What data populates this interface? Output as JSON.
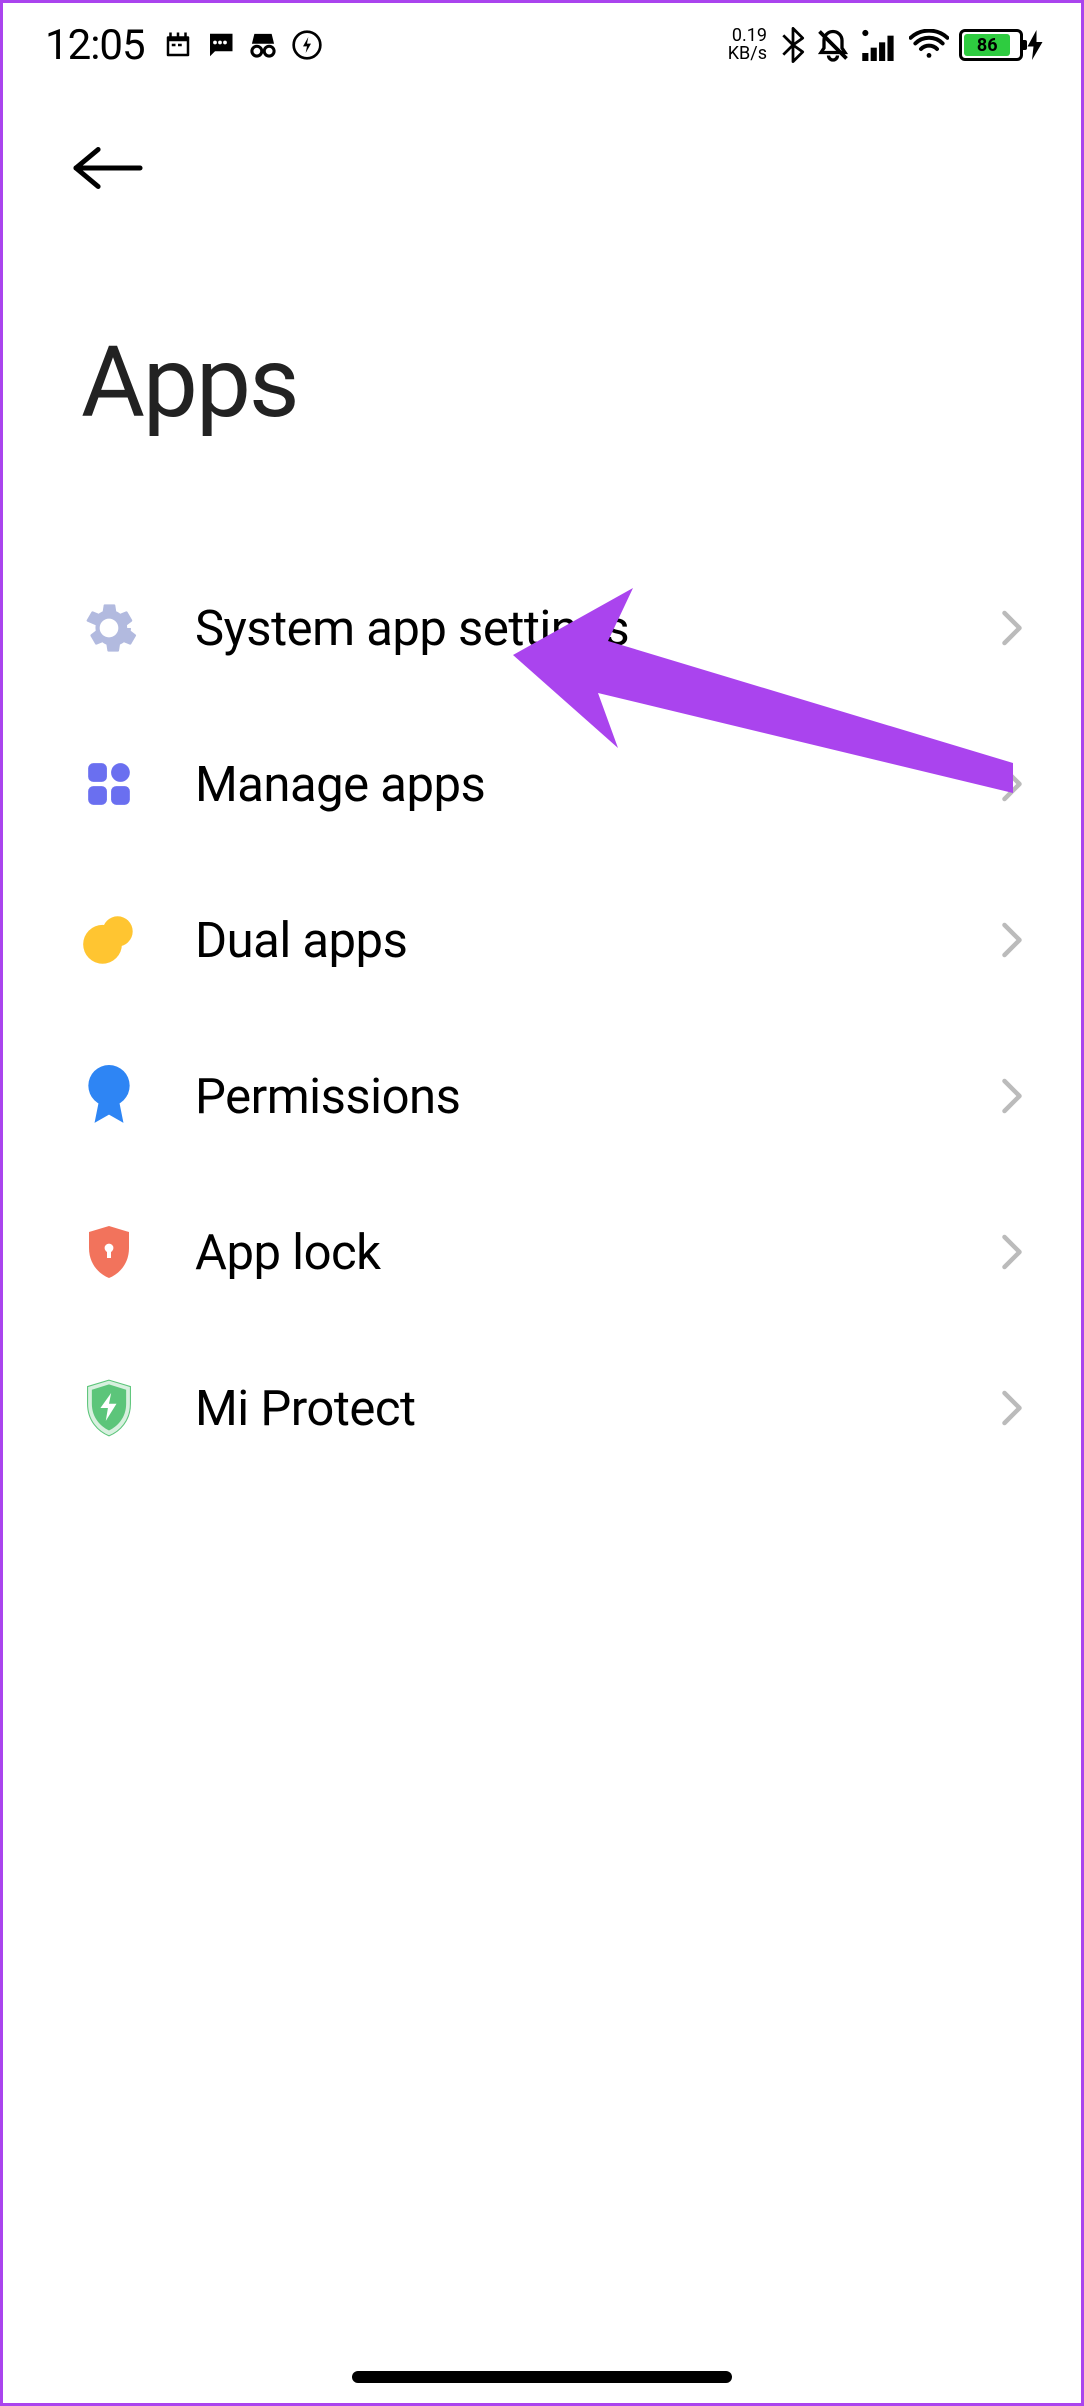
{
  "status": {
    "time": "12:05",
    "netspeed_value": "0.19",
    "netspeed_unit": "KB/s",
    "battery_percent": "86"
  },
  "header": {
    "title": "Apps"
  },
  "menu": {
    "items": [
      {
        "label": "System app settings",
        "icon": "gear"
      },
      {
        "label": "Manage apps",
        "icon": "apps"
      },
      {
        "label": "Dual apps",
        "icon": "dual"
      },
      {
        "label": "Permissions",
        "icon": "badge"
      },
      {
        "label": "App lock",
        "icon": "shield-lock"
      },
      {
        "label": "Mi Protect",
        "icon": "shield-check"
      }
    ]
  },
  "colors": {
    "annotation": "#aa44ee"
  }
}
